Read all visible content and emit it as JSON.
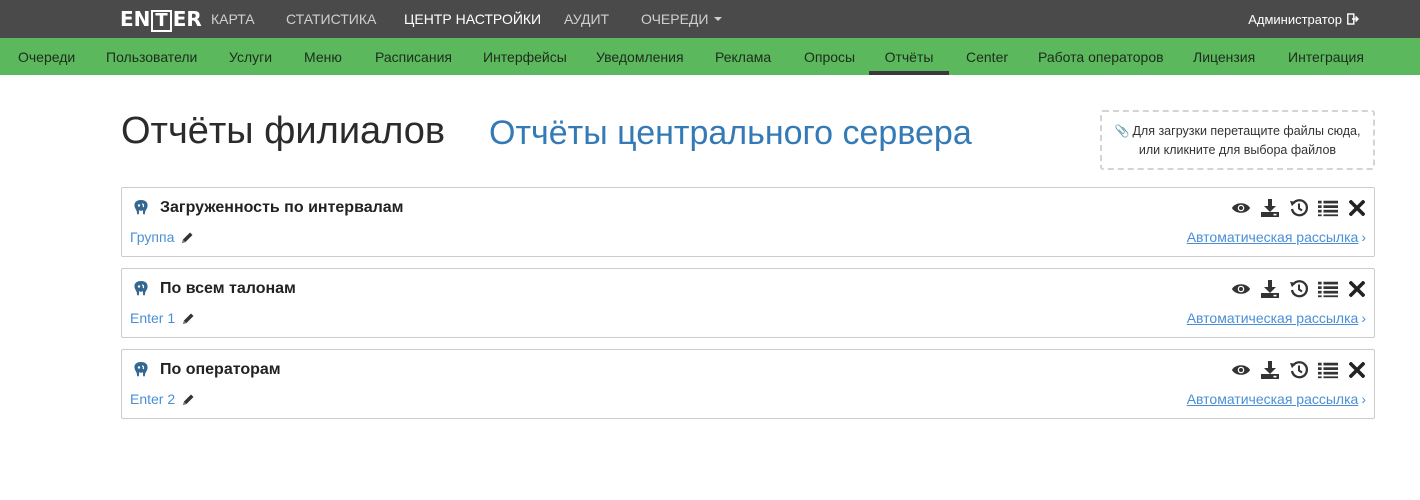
{
  "brand": {
    "logo": "ENTER"
  },
  "topnav": {
    "items": [
      {
        "label": "КАРТА"
      },
      {
        "label": "СТАТИСТИКА"
      },
      {
        "label": "ЦЕНТР НАСТРОЙКИ"
      },
      {
        "label": "АУДИТ"
      },
      {
        "label": "ОЧЕРЕДИ"
      }
    ],
    "user": "Администратор"
  },
  "subnav": {
    "items": [
      {
        "label": "Очереди"
      },
      {
        "label": "Пользователи"
      },
      {
        "label": "Услуги"
      },
      {
        "label": "Меню"
      },
      {
        "label": "Расписания"
      },
      {
        "label": "Интерфейсы"
      },
      {
        "label": "Уведомления"
      },
      {
        "label": "Реклама"
      },
      {
        "label": "Опросы"
      },
      {
        "label": "Отчёты"
      },
      {
        "label": "Center"
      },
      {
        "label": "Работа операторов"
      },
      {
        "label": "Лицензия"
      },
      {
        "label": "Интеграция"
      }
    ],
    "active": "Отчёты"
  },
  "page": {
    "title": "Отчёты филиалов",
    "alt_title": "Отчёты центрального сервера"
  },
  "dropzone": {
    "line1": "Для загрузки перетащите файлы сюда,",
    "line2": "или кликните для выбора файлов"
  },
  "reports": [
    {
      "title": "Загруженность по интервалам",
      "group": "Группа",
      "auto": "Автоматическая рассылка"
    },
    {
      "title": "По всем талонам",
      "group": "Enter 1",
      "auto": "Автоматическая рассылка"
    },
    {
      "title": "По операторам",
      "group": "Enter 2",
      "auto": "Автоматическая рассылка"
    }
  ],
  "colors": {
    "topbar": "#4a4a4a",
    "subbar": "#5cb85c",
    "link": "#337ab7",
    "postgres_blue": "#336791"
  }
}
